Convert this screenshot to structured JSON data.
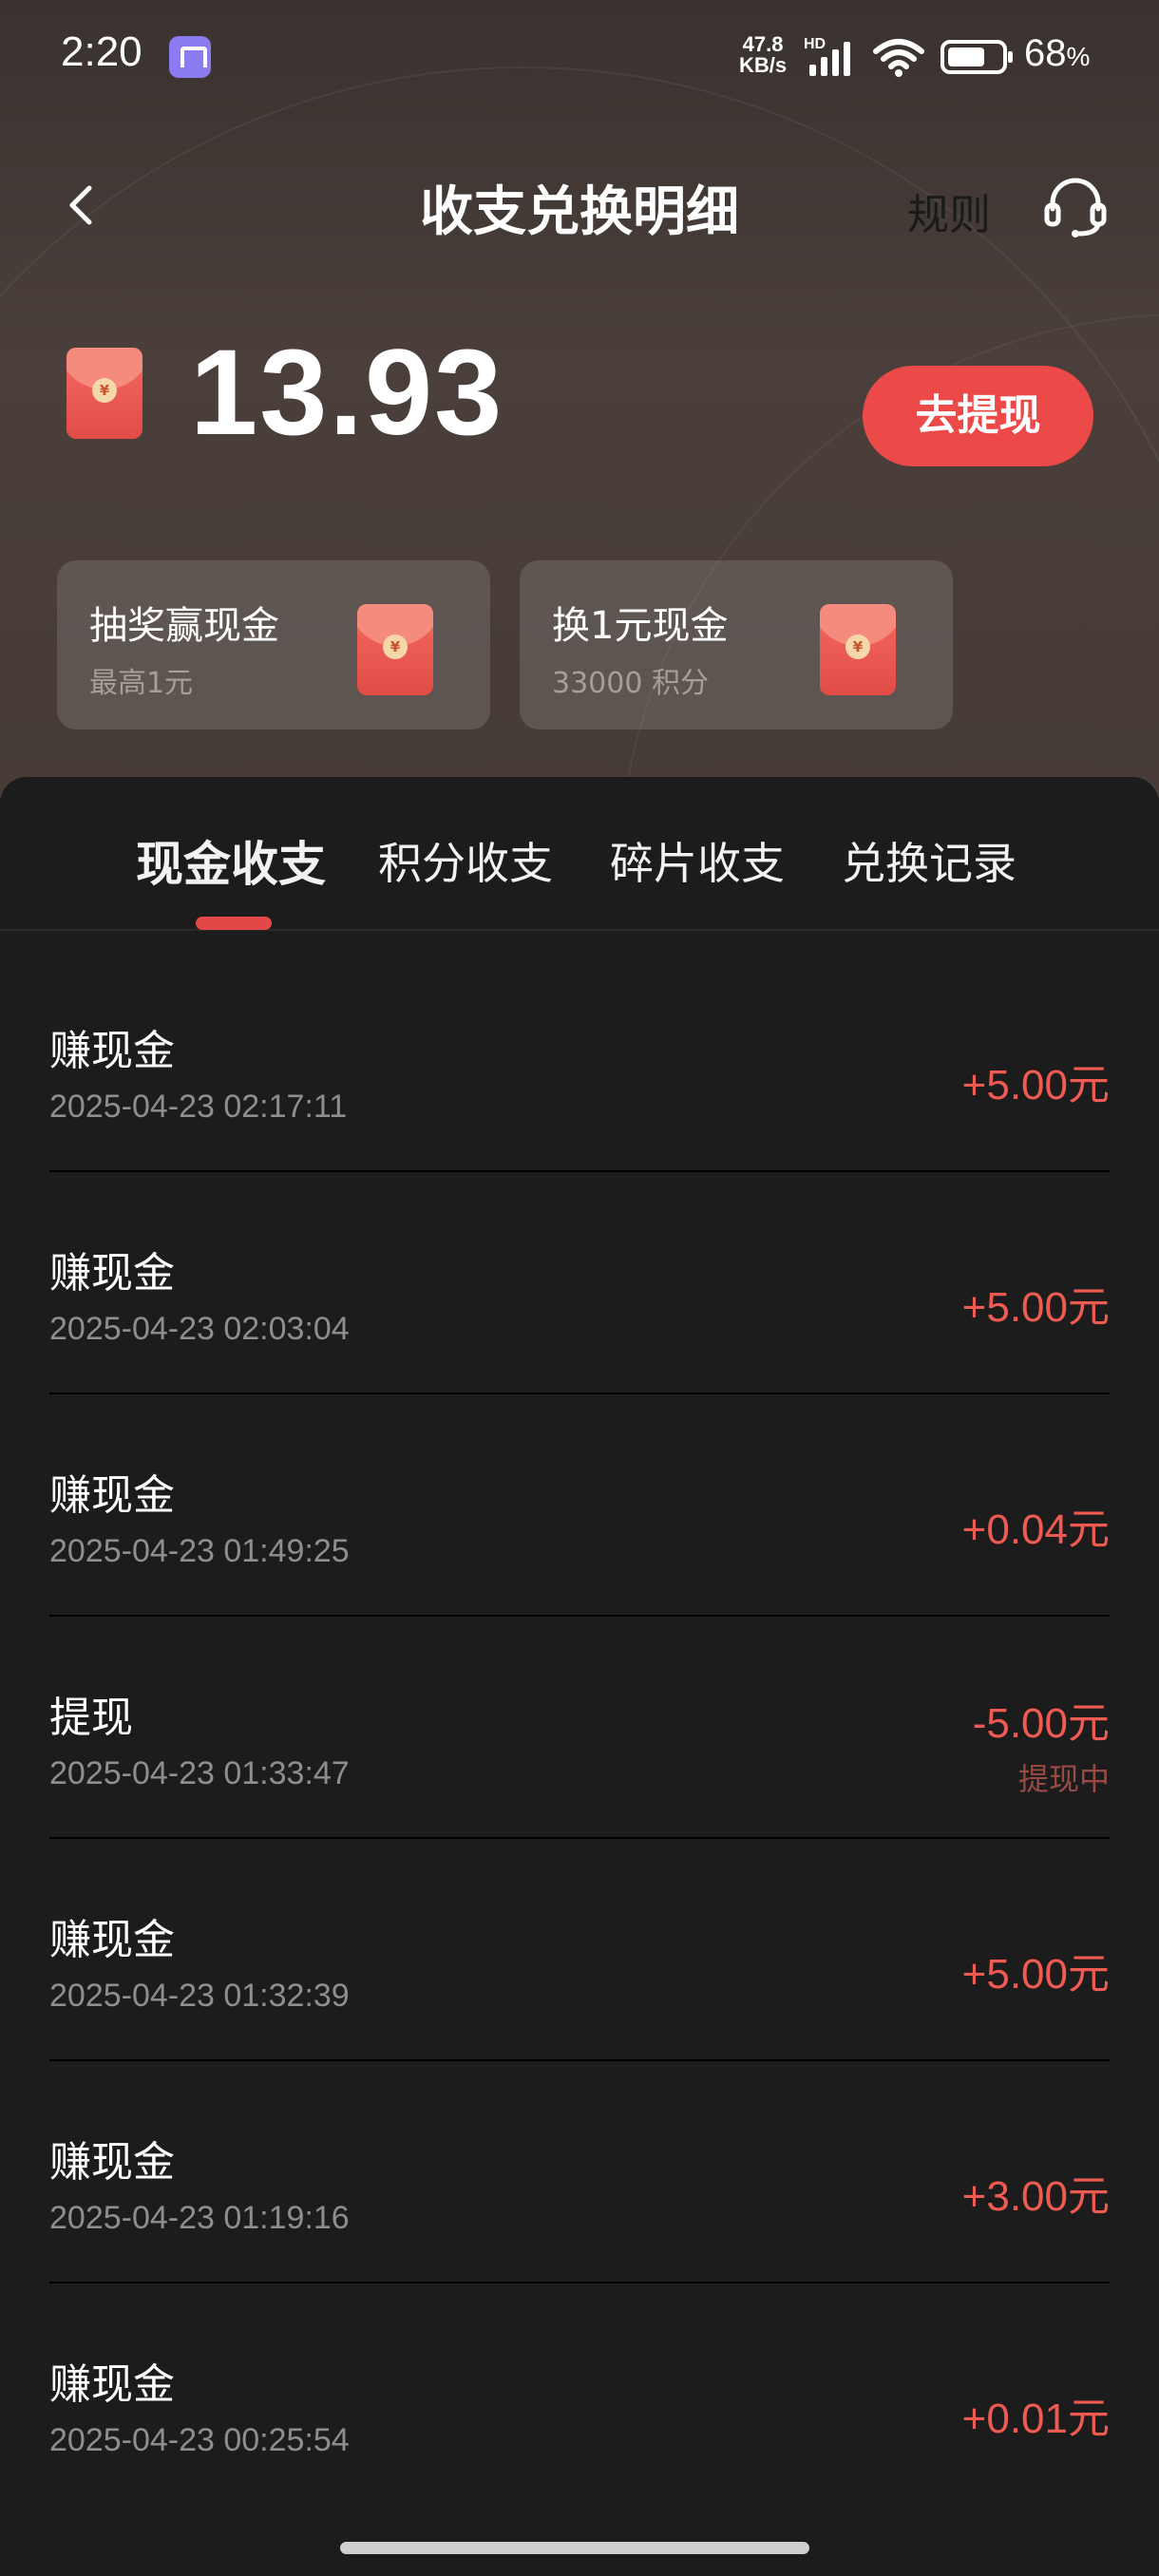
{
  "status_bar": {
    "time": "2:20",
    "net_speed_value": "47.8",
    "net_speed_unit": "KB/s",
    "hd_label": "HD",
    "battery_percent": "68",
    "battery_unit": "%"
  },
  "header": {
    "title": "收支兑换明细",
    "rules_label": "规则"
  },
  "balance": {
    "amount": "13.93",
    "withdraw_label": "去提现"
  },
  "promo_cards": [
    {
      "title": "抽奖赢现金",
      "subtitle": "最高1元"
    },
    {
      "title": "换1元现金",
      "subtitle": "33000 积分"
    }
  ],
  "tabs": [
    {
      "label": "现金收支",
      "active": true
    },
    {
      "label": "积分收支",
      "active": false
    },
    {
      "label": "碎片收支",
      "active": false
    },
    {
      "label": "兑换记录",
      "active": false
    }
  ],
  "transactions": [
    {
      "title": "赚现金",
      "time": "2025-04-23 02:17:11",
      "amount": "+5.00元",
      "status": ""
    },
    {
      "title": "赚现金",
      "time": "2025-04-23 02:03:04",
      "amount": "+5.00元",
      "status": ""
    },
    {
      "title": "赚现金",
      "time": "2025-04-23 01:49:25",
      "amount": "+0.04元",
      "status": ""
    },
    {
      "title": "提现",
      "time": "2025-04-23 01:33:47",
      "amount": "-5.00元",
      "status": "提现中"
    },
    {
      "title": "赚现金",
      "time": "2025-04-23 01:32:39",
      "amount": "+5.00元",
      "status": ""
    },
    {
      "title": "赚现金",
      "time": "2025-04-23 01:19:16",
      "amount": "+3.00元",
      "status": ""
    },
    {
      "title": "赚现金",
      "time": "2025-04-23 00:25:54",
      "amount": "+0.01元",
      "status": ""
    }
  ],
  "icons": {
    "back": "chevron-left-icon",
    "support": "headset-icon",
    "envelope": "red-envelope-icon",
    "coin_symbol": "¥"
  },
  "colors": {
    "accent": "#ec4a48",
    "amount": "#ef5a52",
    "background": "#1c1c1d"
  }
}
